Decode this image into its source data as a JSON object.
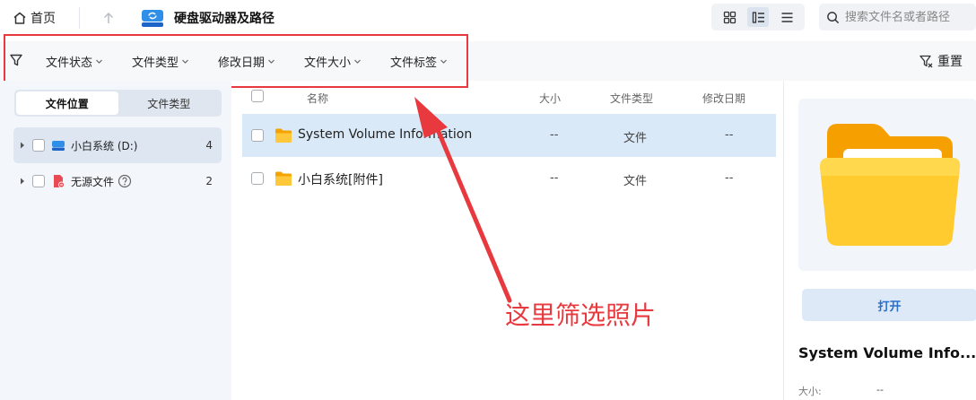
{
  "topbar": {
    "home_label": "首页",
    "drive_title": "硬盘驱动器及路径",
    "search_placeholder": "搜索文件名或者路径"
  },
  "filters": {
    "items": [
      "文件状态",
      "文件类型",
      "修改日期",
      "文件大小",
      "文件标签"
    ],
    "reset_label": "重置"
  },
  "sidebar": {
    "tabs": [
      "文件位置",
      "文件类型"
    ],
    "active_tab": "文件位置",
    "tree": [
      {
        "label": "小白系统 (D:)",
        "count": "4",
        "icon": "drive-icon"
      },
      {
        "label": "无源文件",
        "count": "2",
        "icon": "orphan-file-icon"
      }
    ]
  },
  "list": {
    "columns": {
      "name": "名称",
      "size": "大小",
      "type": "文件类型",
      "date": "修改日期"
    },
    "rows": [
      {
        "name": "System Volume Information",
        "size": "--",
        "type": "文件",
        "date": "--",
        "selected": true
      },
      {
        "name": "小白系统[附件]",
        "size": "--",
        "type": "文件",
        "date": "--",
        "selected": false
      }
    ]
  },
  "preview": {
    "open_label": "打开",
    "name": "System Volume Info...",
    "size_label": "大小:",
    "size_value": "--"
  },
  "annotation": {
    "text": "这里筛选照片",
    "color": "#e8393f"
  },
  "colors": {
    "accent": "#2a6fc9",
    "selected_row": "#d9e9f8",
    "folder": "#f7b500"
  }
}
